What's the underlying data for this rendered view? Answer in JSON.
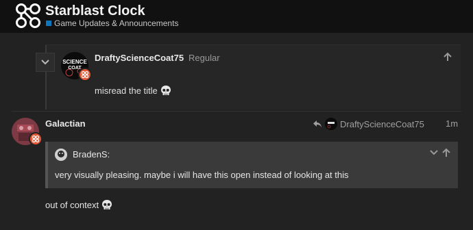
{
  "header": {
    "title": "Starblast Clock",
    "category": "Game Updates & Announcements",
    "category_color": "#0e76bd",
    "logo_icon": "circles-network-logo"
  },
  "embedded_post": {
    "username": "DraftyScienceCoat75",
    "role": "Regular",
    "body": "misread the title",
    "emoji": "skull"
  },
  "post": {
    "username": "Galactian",
    "reply_to_user": "DraftyScienceCoat75",
    "date": "1m",
    "quote": {
      "username": "BradenS:",
      "text": "very visually pleasing. maybe i will have this open instead of looking at this"
    },
    "body": "out of context",
    "emoji": "skull"
  },
  "colors": {
    "badge": "#e45735",
    "background": "#222222",
    "header": "#111111"
  }
}
